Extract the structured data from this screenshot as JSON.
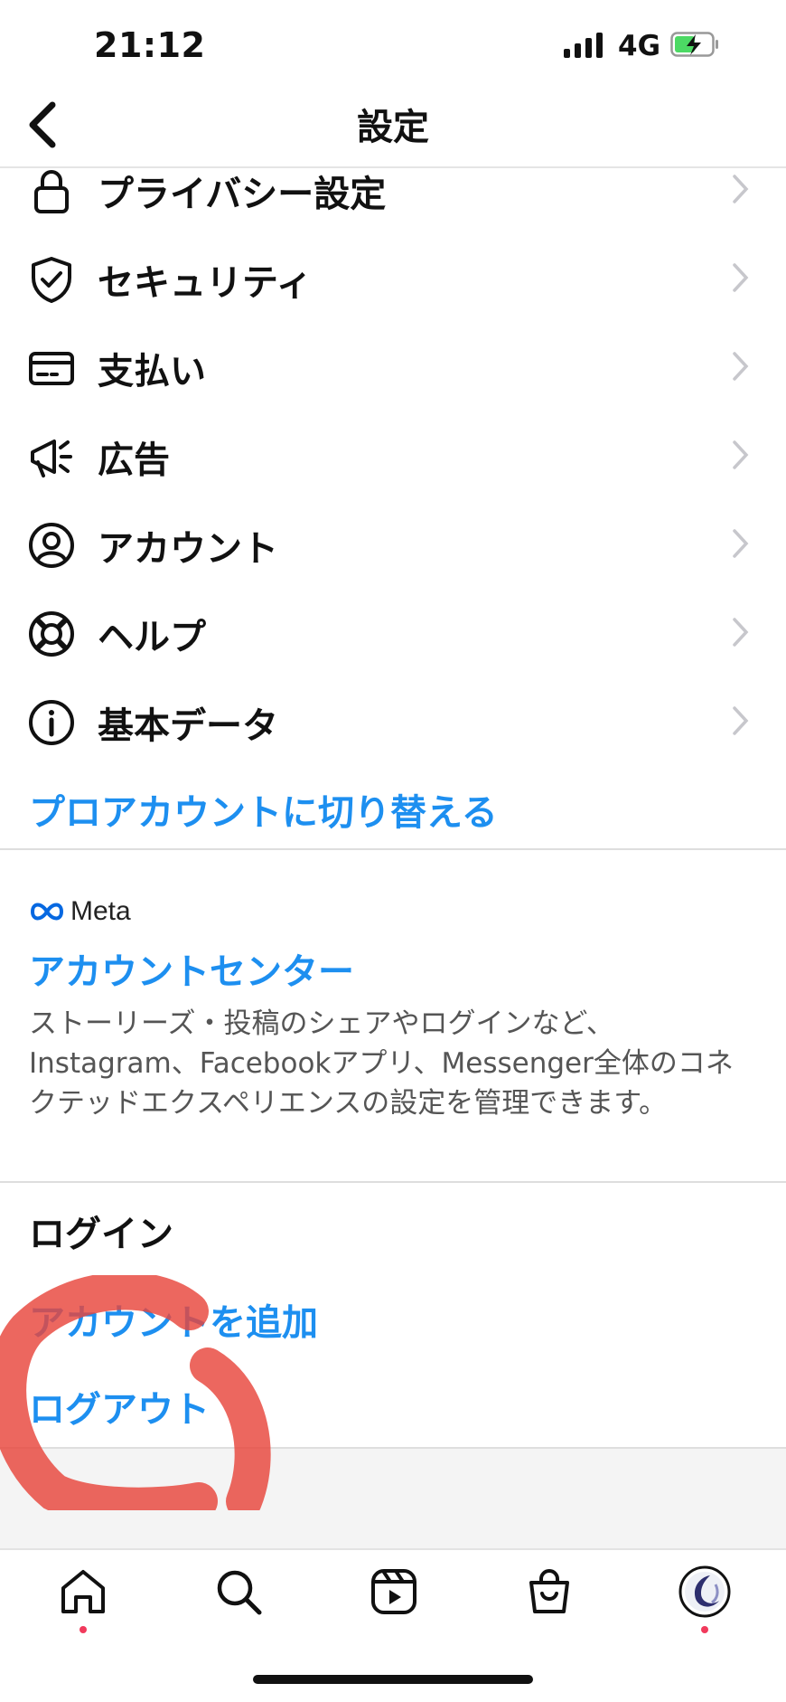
{
  "status_bar": {
    "time": "21:12",
    "network": "4G",
    "battery_charging": true
  },
  "header": {
    "title": "設定"
  },
  "menu_items": [
    {
      "label": "プライバシー設定",
      "icon": "lock-icon"
    },
    {
      "label": "セキュリティ",
      "icon": "shield-icon"
    },
    {
      "label": "支払い",
      "icon": "card-icon"
    },
    {
      "label": "広告",
      "icon": "megaphone-icon"
    },
    {
      "label": "アカウント",
      "icon": "account-icon"
    },
    {
      "label": "ヘルプ",
      "icon": "lifebuoy-icon"
    },
    {
      "label": "基本データ",
      "icon": "info-icon"
    }
  ],
  "pro_account_link": "プロアカウントに切り替える",
  "meta_section": {
    "logo_text": "Meta",
    "title": "アカウントセンター",
    "description": "ストーリーズ・投稿のシェアやログインなど、Instagram、Facebookアプリ、Messenger全体のコネクテッドエクスペリエンスの設定を管理できます。"
  },
  "login_section": {
    "heading": "ログイン",
    "add_account": "アカウントを追加",
    "logout": "ログアウト"
  },
  "tab_bar": [
    "home-icon",
    "search-icon",
    "reels-icon",
    "shop-icon",
    "profile-avatar"
  ],
  "colors": {
    "link": "#1d8ff0",
    "annotation": "#e8453c",
    "notification_dot": "#f13a5c"
  }
}
